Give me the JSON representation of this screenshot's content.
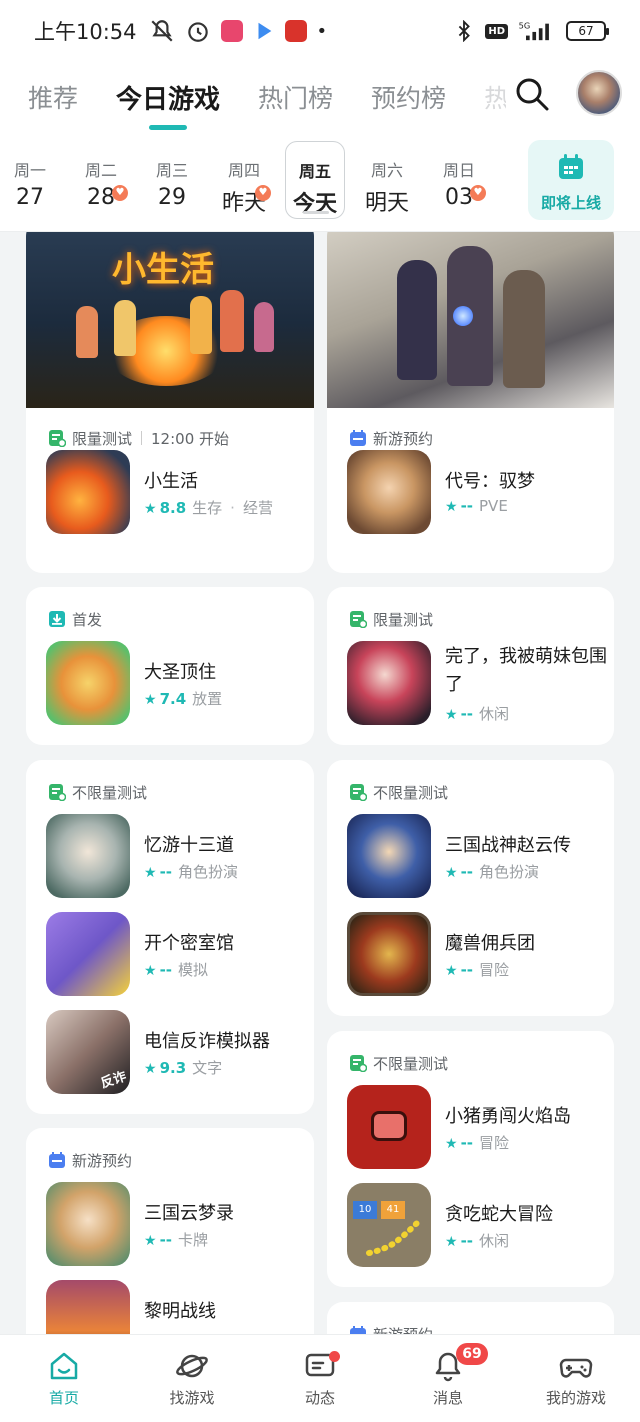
{
  "status_bar": {
    "time": "上午10:54",
    "network": "5G",
    "battery": "67",
    "hd": "HD"
  },
  "top_tabs": [
    "推荐",
    "今日游戏",
    "热门榜",
    "预约榜",
    "热"
  ],
  "week": [
    {
      "name": "周一",
      "num": "27",
      "heart": false
    },
    {
      "name": "周二",
      "num": "28",
      "heart": true
    },
    {
      "name": "周三",
      "num": "29",
      "heart": false
    },
    {
      "name": "周四",
      "num": "昨天",
      "heart": true
    },
    {
      "name": "周五",
      "num": "今天",
      "heart": false,
      "active": true
    },
    {
      "name": "周六",
      "num": "明天",
      "heart": false
    },
    {
      "name": "周日",
      "num": "03",
      "heart": true
    }
  ],
  "upcoming_label": "即将上线",
  "cards": {
    "c1": {
      "banner_text": "小生活",
      "tag": "限量测试",
      "tag_time": "12:00 开始",
      "games": [
        {
          "title": "小生活",
          "rating": "8.8",
          "genres": [
            "生存",
            "经营"
          ]
        }
      ]
    },
    "c2": {
      "tag": "新游预约",
      "games": [
        {
          "title": "代号：驭梦",
          "rating": "--",
          "genres": [
            "PVE"
          ]
        }
      ]
    },
    "c3": {
      "tag": "首发",
      "games": [
        {
          "title": "大圣顶住",
          "rating": "7.4",
          "genres": [
            "放置"
          ]
        }
      ]
    },
    "c4": {
      "tag": "限量测试",
      "games": [
        {
          "title": "完了，我被萌妹包围了",
          "rating": "--",
          "genres": [
            "休闲"
          ]
        }
      ]
    },
    "c5": {
      "tag": "不限量测试",
      "games": [
        {
          "title": "忆游十三道",
          "rating": "--",
          "genres": [
            "角色扮演"
          ]
        },
        {
          "title": "开个密室馆",
          "rating": "--",
          "genres": [
            "模拟"
          ]
        },
        {
          "title": "电信反诈模拟器",
          "rating": "9.3",
          "genres": [
            "文字"
          ],
          "icon_text": "反诈"
        }
      ]
    },
    "c6": {
      "tag": "不限量测试",
      "games": [
        {
          "title": "三国战神赵云传",
          "rating": "--",
          "genres": [
            "角色扮演"
          ]
        },
        {
          "title": "魔兽佣兵团",
          "rating": "--",
          "genres": [
            "冒险"
          ]
        }
      ]
    },
    "c7": {
      "tag": "不限量测试",
      "games": [
        {
          "title": "小猪勇闯火焰岛",
          "rating": "--",
          "genres": [
            "冒险"
          ]
        },
        {
          "title": "贪吃蛇大冒险",
          "rating": "--",
          "genres": [
            "休闲"
          ],
          "icon_nums": [
            "10",
            "41"
          ]
        }
      ]
    },
    "c8": {
      "tag": "新游预约",
      "games": [
        {
          "title": "三国云梦录",
          "rating": "--",
          "genres": [
            "卡牌"
          ]
        },
        {
          "title": "黎明战线",
          "rating": "--",
          "genres": [
            ""
          ]
        }
      ]
    },
    "c9": {
      "tag": "新游预约"
    }
  },
  "bottom_nav": [
    {
      "label": "首页",
      "active": true
    },
    {
      "label": "找游戏"
    },
    {
      "label": "动态",
      "dot": true
    },
    {
      "label": "消息",
      "badge": "69"
    },
    {
      "label": "我的游戏"
    }
  ],
  "colors": {
    "accent": "#1fb9b4",
    "heart": "#f47b57",
    "badge": "#f04848"
  }
}
